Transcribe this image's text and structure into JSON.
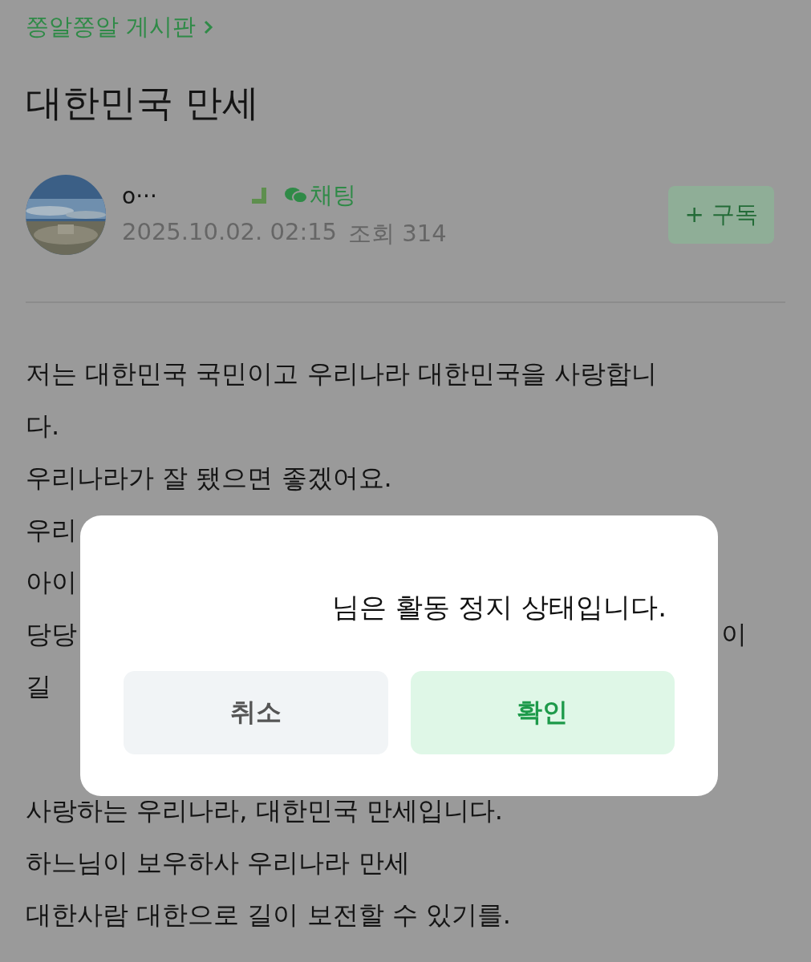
{
  "breadcrumb": {
    "board": "쫑알쫑알 게시판"
  },
  "post": {
    "title": "대한민국 만세",
    "author_name": "o···",
    "chat_label": "채팅",
    "date": "2025.10.02. 02:15",
    "views": "조회 314",
    "subscribe_label": "+ 구독"
  },
  "body_lines": [
    {
      "kind": "text",
      "left": "저는 대한민국 국민이고 우리나라 대한민국을 사랑합니"
    },
    {
      "kind": "text",
      "left": "다."
    },
    {
      "kind": "text",
      "left": "우리나라가 잘 됐으면 좋겠어요."
    },
    {
      "kind": "text",
      "left": "우리"
    },
    {
      "kind": "text",
      "left": "아이"
    },
    {
      "kind": "text",
      "left": "당당",
      "right": "이"
    },
    {
      "kind": "text",
      "left": "길"
    },
    {
      "kind": "blank"
    },
    {
      "kind": "text",
      "left": "사랑하는 우리나라, 대한민국 만세입니다."
    },
    {
      "kind": "text",
      "left": "하느님이 보우하사 우리나라 만세"
    },
    {
      "kind": "text",
      "left": "대한사람 대한으로 길이 보전할 수 있기를."
    }
  ],
  "dialog": {
    "message": "님은 활동 정지 상태입니다.",
    "buttons": [
      {
        "label": "취소",
        "kind": "secondary"
      },
      {
        "label": "확인",
        "kind": "primary"
      }
    ]
  }
}
